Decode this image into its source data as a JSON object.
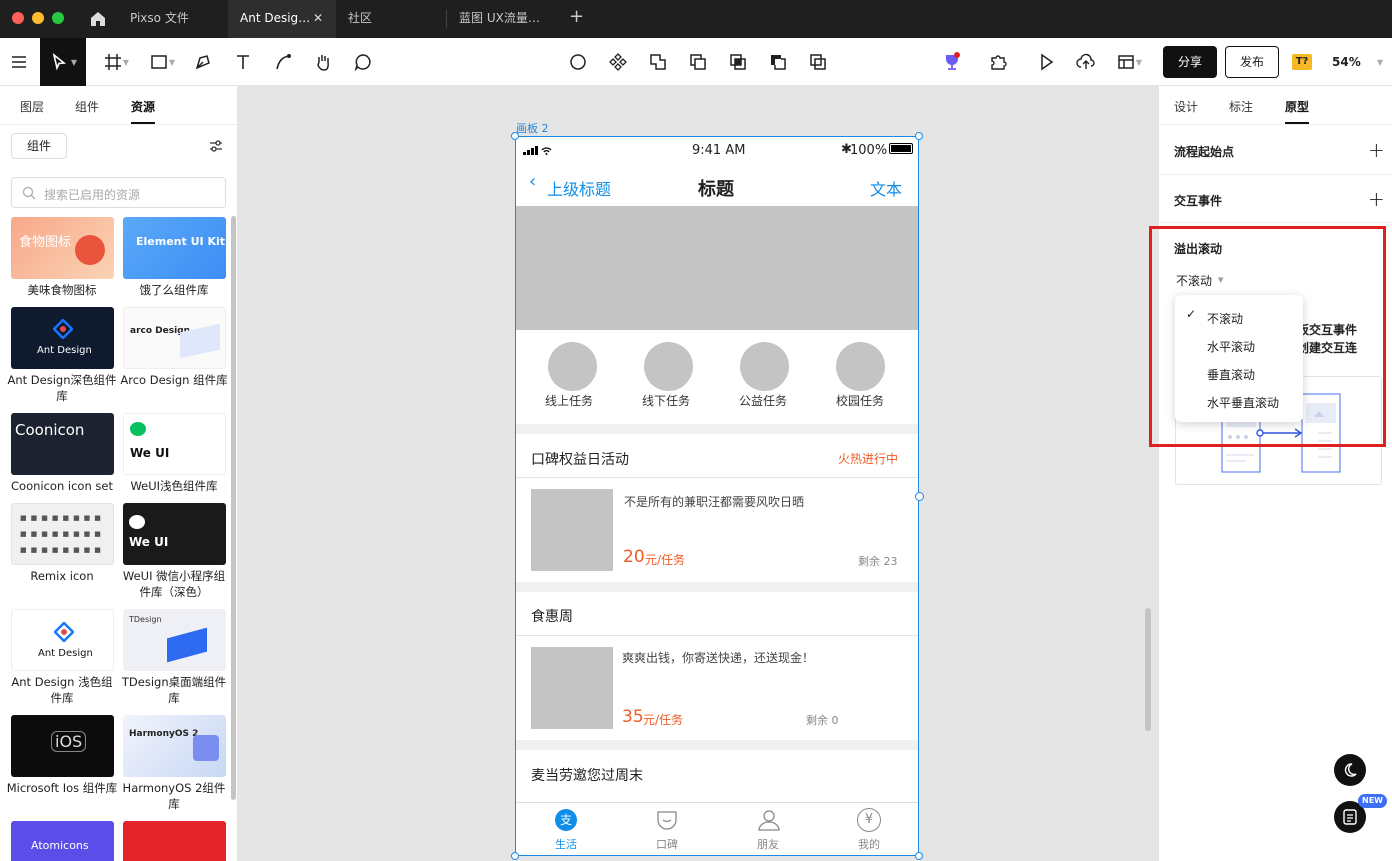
{
  "tabs": [
    {
      "label": "Pixso 文件"
    },
    {
      "label": "Ant Desig…"
    },
    {
      "label": "社区"
    },
    {
      "label": "蓝图 UX流量…"
    }
  ],
  "toolbar": {
    "share_label": "分享",
    "publish_label": "发布",
    "zoom": "54%",
    "font_missing": "T?"
  },
  "left_panel": {
    "tabs": [
      "图层",
      "组件",
      "资源"
    ],
    "active_tab": "资源",
    "filter_chip": "组件",
    "search_placeholder": "搜索已启用的资源",
    "libraries": [
      {
        "name": "美味食物图标",
        "thumb_text": "食物图标"
      },
      {
        "name": "饿了么组件库",
        "thumb_text": "Element UI Kit"
      },
      {
        "name": "Ant Design深色组件库",
        "thumb_text": "Ant Design"
      },
      {
        "name": "Arco Design 组件库",
        "thumb_text": "arco Design"
      },
      {
        "name": "Coonicon icon set",
        "thumb_text": "Coonicon"
      },
      {
        "name": "WeUI浅色组件库",
        "thumb_text": "We UI"
      },
      {
        "name": "Remix icon",
        "thumb_text": ""
      },
      {
        "name": "WeUI 微信小程序组件库（深色）",
        "thumb_text": "We UI"
      },
      {
        "name": "Ant Design 浅色组件库",
        "thumb_text": "Ant Design"
      },
      {
        "name": "TDesign桌面端组件库",
        "thumb_text": "TDesign"
      },
      {
        "name": "Microsoft Ios 组件库",
        "thumb_text": "iOS"
      },
      {
        "name": "HarmonyOS 2组件库",
        "thumb_text": "HarmonyOS 2"
      },
      {
        "name": "",
        "thumb_text": "Atomicons"
      },
      {
        "name": "",
        "thumb_text": ""
      }
    ]
  },
  "canvas": {
    "frame_label": "画板 2",
    "phone": {
      "status_time": "9:41 AM",
      "battery": "100%",
      "nav_back": "上级标题",
      "nav_title": "标题",
      "nav_right": "文本",
      "categories": [
        "线上任务",
        "线下任务",
        "公益任务",
        "校园任务"
      ],
      "section1_title": "口碑权益日活动",
      "section1_status": "火热进行中",
      "item1_desc": "不是所有的兼职汪都需要风吹日晒",
      "item1_price": "20",
      "item1_unit": "元/任务",
      "item1_remain": "剩余 23",
      "section2_title": "食惠周",
      "item2_desc": "爽爽出钱，你寄送快递，还送现金！",
      "item2_price": "35",
      "item2_unit": "元/任务",
      "item2_remain": "剩余 0",
      "section3_title": "麦当劳邀您过周末",
      "tabbar": [
        "生活",
        "口碑",
        "朋友",
        "我的"
      ],
      "tabbar_icon_life": "支"
    }
  },
  "right_panel": {
    "tabs": [
      "设计",
      "标注",
      "原型"
    ],
    "active_tab": "原型",
    "flow_start": "流程起始点",
    "interaction": "交互事件",
    "overflow_title": "溢出滚动",
    "overflow_value": "不滚动",
    "menu_options": [
      "不滚动",
      "水平滚动",
      "垂直滚动",
      "水平垂直滚动"
    ],
    "hint_line1": "面板交互事件",
    "hint_line2": "，创建交互连",
    "new_badge": "NEW"
  },
  "colors": {
    "accent_blue": "#108ee9",
    "orange": "#f05a24",
    "highlight_red": "#e02020"
  }
}
